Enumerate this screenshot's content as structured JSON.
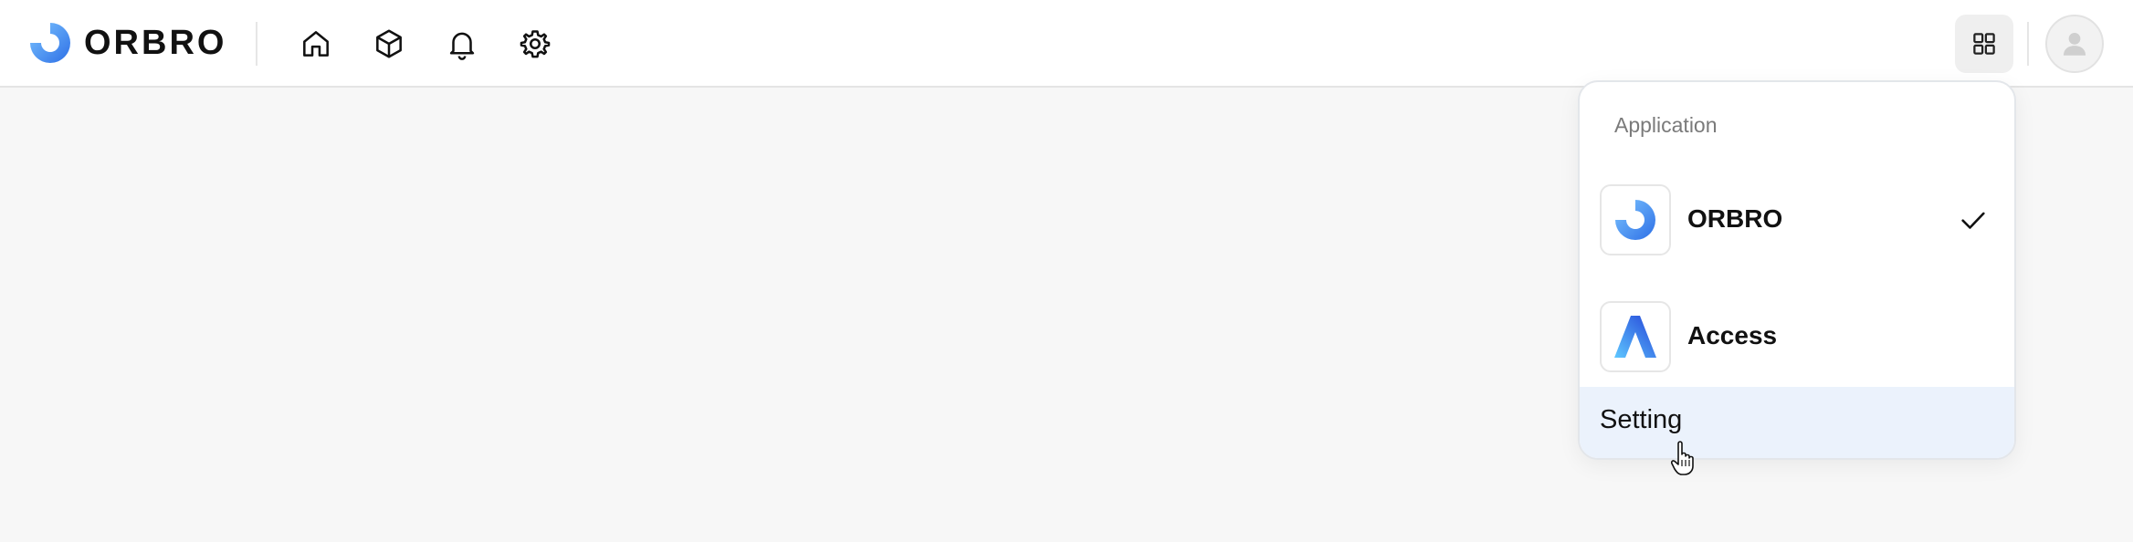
{
  "brand": {
    "name": "ORBRO"
  },
  "nav": {
    "home_icon": "home-icon",
    "products_icon": "box-icon",
    "notifications_icon": "bell-icon",
    "settings_icon": "gear-icon"
  },
  "header_right": {
    "apps_icon": "grid-icon",
    "avatar_icon": "user-icon"
  },
  "app_menu": {
    "heading": "Application",
    "items": [
      {
        "name": "ORBRO",
        "icon": "orbro-logo-icon",
        "selected": true
      },
      {
        "name": "Access",
        "icon": "access-logo-icon",
        "selected": false
      }
    ],
    "setting_label": "Setting"
  },
  "colors": {
    "accent": "#3d8df0",
    "setting_highlight": "#ebf2fc"
  }
}
